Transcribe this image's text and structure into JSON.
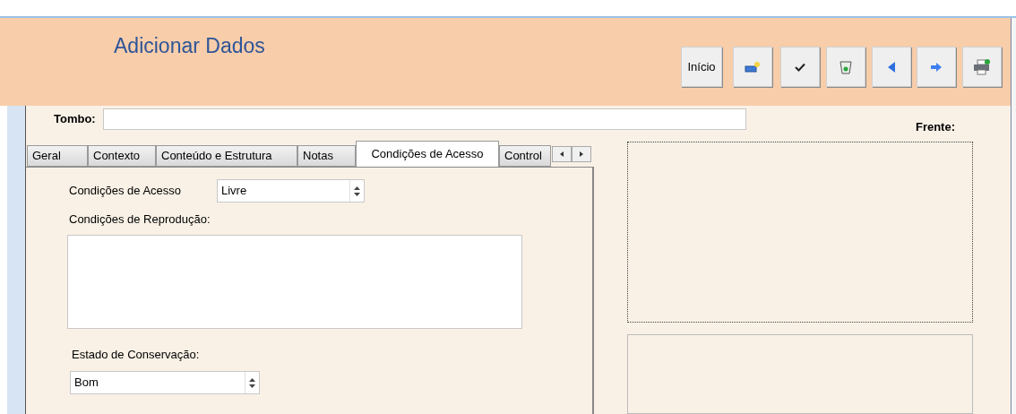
{
  "header": {
    "title": "Adicionar Dados",
    "home_button": "Início"
  },
  "tombo": {
    "label": "Tombo:"
  },
  "front": {
    "label": "Frente:"
  },
  "tabs": [
    {
      "label": "Geral",
      "selected": false
    },
    {
      "label": "Contexto",
      "selected": false
    },
    {
      "label": "Conteúdo e Estrutura",
      "selected": false
    },
    {
      "label": "Notas",
      "selected": false
    },
    {
      "label": "Condições de Acesso",
      "selected": true
    },
    {
      "label": "Control",
      "selected": false
    }
  ],
  "panel": {
    "access": {
      "label": "Condições de Acesso",
      "value": "Livre"
    },
    "reproduction": {
      "label": "Condições de Reprodução:"
    },
    "conservation": {
      "label": "Estado de Conservação:",
      "value": "Bom"
    }
  }
}
